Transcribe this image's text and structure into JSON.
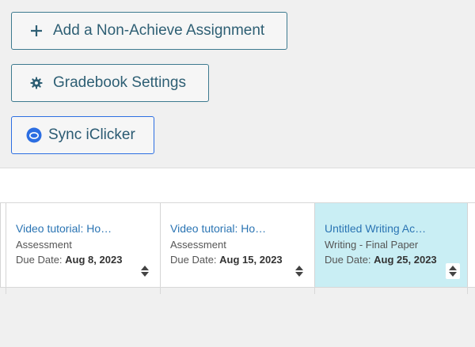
{
  "toolbar": {
    "add_assignment_label": "Add a Non-Achieve Assignment",
    "gradebook_settings_label": "Gradebook Settings",
    "sync_iclicker_label": "Sync iClicker"
  },
  "assignments": [
    {
      "title": "Video tutorial: Ho…",
      "type": "Assessment",
      "due_prefix": "Due Date:",
      "due_date": "Aug 8, 2023"
    },
    {
      "title": "Video tutorial: Ho…",
      "type": "Assessment",
      "due_prefix": "Due Date:",
      "due_date": "Aug 15, 2023"
    },
    {
      "title": "Untitled Writing Ac…",
      "type": "Writing - Final Paper",
      "due_prefix": "Due Date:",
      "due_date": "Aug 25, 2023",
      "active": true
    }
  ],
  "colors": {
    "accent": "#3d7a8f",
    "sync_border": "#2c6ee2",
    "active_column": "#c9eef4",
    "link": "#2a74b3"
  },
  "icons": {
    "add": "plus-icon",
    "settings": "gear-icon",
    "sync": "iclicker-icon",
    "sort": "sort-icon"
  }
}
